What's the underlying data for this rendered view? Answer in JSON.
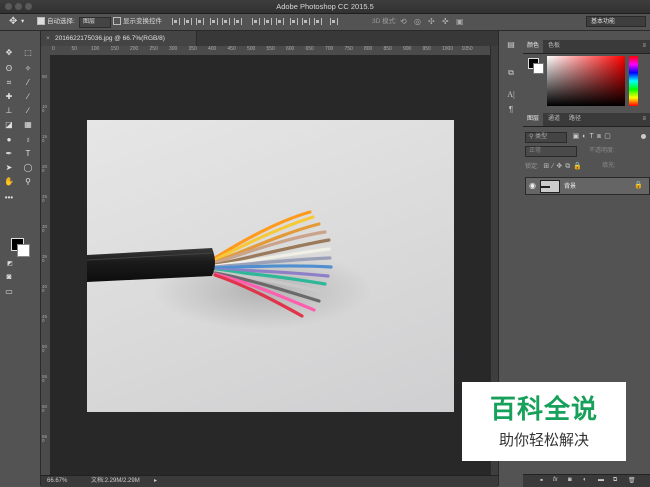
{
  "window": {
    "title": "Adobe Photoshop CC 2015.5"
  },
  "options_bar": {
    "auto_select_label": "自动选择:",
    "auto_select_target": "图层",
    "show_transform_label": "显示变换控件",
    "mode_3d_label": "3D 模式:",
    "workspace": "基本功能"
  },
  "document": {
    "tab_label": "20166221750​36.jpg @ 66.7%(RGB/8)",
    "zoom": "66.67%",
    "doc_size": "文档:2.29M/2.29M"
  },
  "ruler": {
    "h_ticks": [
      "0",
      "50",
      "100",
      "150",
      "200",
      "250",
      "300",
      "350",
      "400",
      "450",
      "500",
      "550",
      "600",
      "650",
      "700",
      "750",
      "800",
      "850",
      "900",
      "950",
      "1000",
      "1050"
    ],
    "v_ticks": [
      "50",
      "100",
      "150",
      "200",
      "250",
      "300",
      "350",
      "400",
      "450",
      "500",
      "550",
      "600",
      "650"
    ]
  },
  "color_panel": {
    "tabs": [
      "颜色",
      "色板"
    ]
  },
  "layers_panel": {
    "tabs": [
      "图层",
      "通道",
      "路径"
    ],
    "filter_kind": "类型",
    "blend_mode": "正常",
    "opacity_label": "不透明度:",
    "lock_label": "锁定:",
    "fill_label": "填充:",
    "layer_name": "背景"
  },
  "watermark": {
    "main": "百科全说",
    "sub": "助你轻松解决"
  },
  "colors": {
    "accent_green": "#16a05a"
  }
}
